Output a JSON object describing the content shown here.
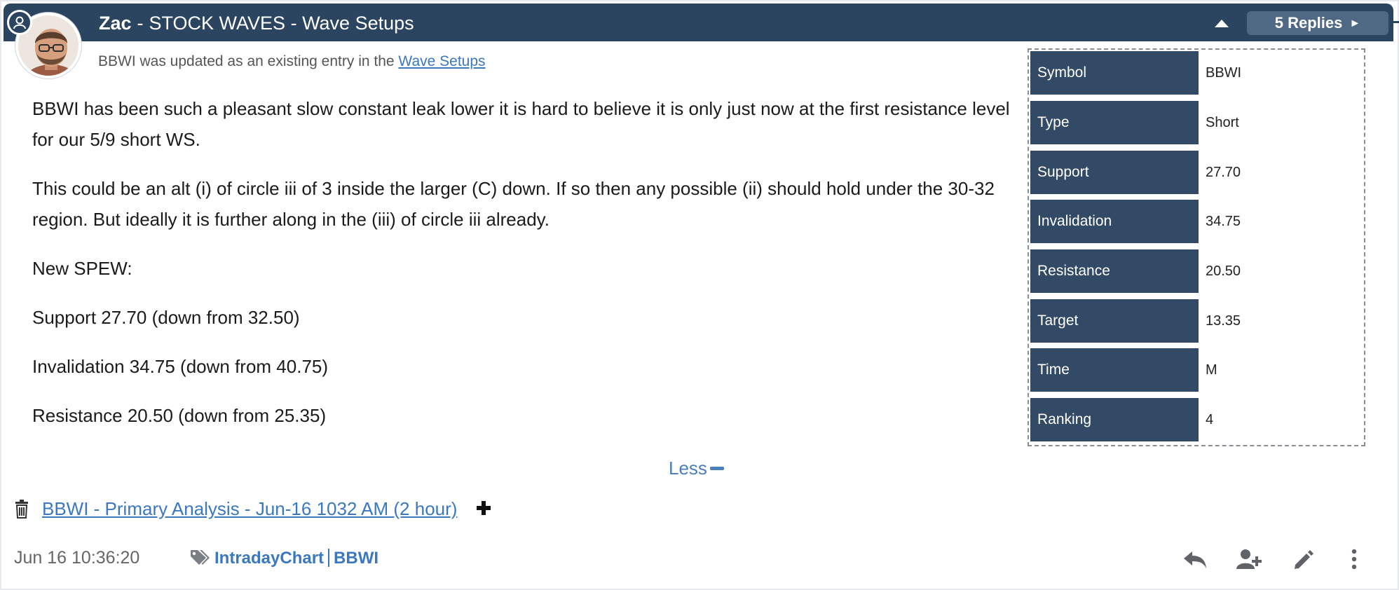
{
  "header": {
    "author": "Zac",
    "separator": "-",
    "title": "STOCK WAVES - Wave Setups",
    "replies_label": "5 Replies"
  },
  "post": {
    "updated_prefix": "BBWI was updated as an existing entry in the",
    "updated_link": "Wave Setups",
    "paragraphs": [
      "BBWI has been such a pleasant slow constant leak lower it is hard to believe it is only just now at the first resistance level for our 5/9 short WS.",
      "This could be an alt (i) of circle iii of 3 inside the larger (C) down. If so then any possible (ii) should hold under the 30-32 region. But ideally it is further along in the (iii) of circle iii already.",
      "New SPEW:",
      "Support 27.70 (down from 32.50)",
      "Invalidation 34.75 (down from 40.75)",
      "Resistance 20.50 (down from 25.35)"
    ],
    "less_label": "Less"
  },
  "info_table": [
    {
      "label": "Symbol",
      "value": "BBWI"
    },
    {
      "label": "Type",
      "value": "Short"
    },
    {
      "label": "Support",
      "value": "27.70"
    },
    {
      "label": "Invalidation",
      "value": "34.75"
    },
    {
      "label": "Resistance",
      "value": "20.50"
    },
    {
      "label": "Target",
      "value": "13.35"
    },
    {
      "label": "Time",
      "value": "M"
    },
    {
      "label": "Ranking",
      "value": "4"
    }
  ],
  "attachment": {
    "link": "BBWI - Primary Analysis - Jun-16 1032 AM (2 hour)"
  },
  "footer": {
    "timestamp": "Jun 16 10:36:20",
    "tags": [
      "IntradayChart",
      "BBWI"
    ]
  },
  "colors": {
    "header_bg": "#2b4561",
    "label_bg": "#324a66",
    "link": "#3a78c2",
    "replies_bg": "#4f6884"
  },
  "icons": {
    "collapse": "caret-up-icon",
    "replies": "chevron-right-icon",
    "attachment_delete": "trash-icon",
    "attachment_add": "plus-icon",
    "tags": "tags-icon",
    "reply": "reply-icon",
    "follow": "user-plus-icon",
    "edit": "pencil-icon",
    "more": "more-vertical-icon"
  }
}
